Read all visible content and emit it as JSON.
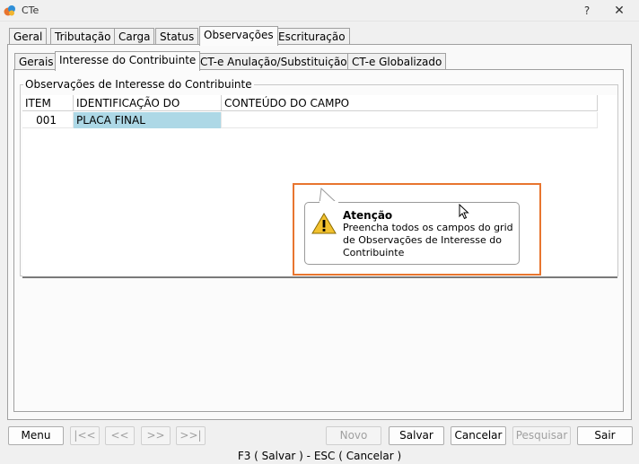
{
  "window": {
    "title": "CTe",
    "help_label": "?",
    "close_label": "✕"
  },
  "main_tabs": [
    "Geral",
    "Tributação",
    "Carga",
    "Status",
    "Observações",
    "Escrituração"
  ],
  "sub_tabs": [
    "Gerais",
    "Interesse do Contribuinte",
    "CT-e Anulação/Substituição",
    "CT-e Globalizado"
  ],
  "group": {
    "title": "Observações de Interesse do Contribuinte"
  },
  "grid": {
    "headers": [
      "ITEM",
      "IDENTIFICAÇÃO DO CAMPO",
      "CONTEÚDO DO CAMPO"
    ],
    "rows": [
      {
        "item": "001",
        "identificacao": "PLACA FINAL",
        "conteudo": ""
      }
    ]
  },
  "callout": {
    "title": "Atenção",
    "message": "Preencha todos os campos do grid de Observações de Interesse do Contribuinte",
    "icon": "warning-icon",
    "highlight_color": "#e8752f"
  },
  "buttons": {
    "menu": "Menu",
    "first": "|<<",
    "prev": "<<",
    "next": ">>",
    "last": ">>|",
    "novo": "Novo",
    "salvar": "Salvar",
    "cancelar": "Cancelar",
    "pesquisar": "Pesquisar",
    "sair": "Sair"
  },
  "status_bar": "F3 ( Salvar )   -   ESC ( Cancelar )"
}
